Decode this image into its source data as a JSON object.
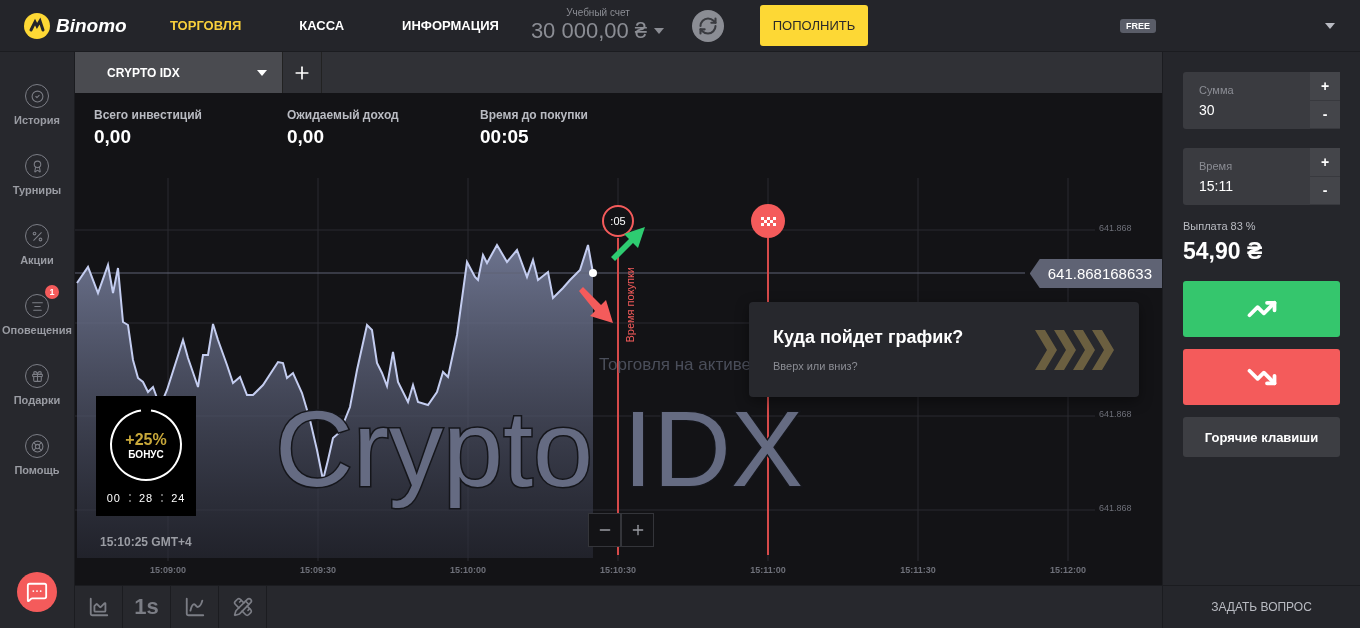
{
  "header": {
    "logo": "Binomo",
    "nav": [
      {
        "label": "ТОРГОВЛЯ",
        "selected": true
      },
      {
        "label": "КАССА",
        "selected": false
      },
      {
        "label": "ИНФОРМАЦИЯ",
        "selected": false
      }
    ],
    "account": {
      "label": "Учебный счет",
      "balance": "30 000,00 ₴"
    },
    "deposit_button": "ПОПОЛНИТЬ",
    "badge": "FREE"
  },
  "sidebar": {
    "items": [
      {
        "label": "История"
      },
      {
        "label": "Турниры"
      },
      {
        "label": "Акции"
      },
      {
        "label": "Оповещения",
        "badge": "1"
      },
      {
        "label": "Подарки"
      },
      {
        "label": "Помощь"
      }
    ]
  },
  "asset_tabs": [
    {
      "label": "CRYPTO IDX",
      "selected": true
    }
  ],
  "stats": [
    {
      "label": "Всего инвестиций",
      "value": "0,00"
    },
    {
      "label": "Ожидаемый доход",
      "value": "0,00"
    },
    {
      "label": "Время до покупки",
      "value": "00:05"
    }
  ],
  "chart": {
    "watermark": "Crypto IDX",
    "subtitle": "Торговля на активе",
    "countdown": ":05",
    "purchase_label": "Время покупки",
    "current_price": "641.868168633",
    "y_ticks": [
      "641.868",
      "641.868",
      "641.868"
    ],
    "x_ticks": [
      "15:09:00",
      "15:09:30",
      "15:10:00",
      "15:10:30",
      "15:11:00",
      "15:11:30",
      "15:12:00"
    ],
    "clock": "15:10:25 GMT+4"
  },
  "prompt": {
    "title": "Куда пойдет график?",
    "subtitle": "Вверх или вниз?"
  },
  "bonus": {
    "percent": "+25%",
    "label": "БОНУС",
    "timer": [
      "00",
      "28",
      "24"
    ]
  },
  "toolbar": {
    "interval": "1s"
  },
  "trade": {
    "fields": [
      {
        "label": "Сумма",
        "value": "30",
        "increment": "+",
        "decrement": "-"
      },
      {
        "label": "Время",
        "value": "15:11",
        "increment": "+",
        "decrement": "-"
      }
    ],
    "payout_label": "Выплата 83 %",
    "payout": "54,90 ₴",
    "hotkeys": "Горячие клавиши"
  },
  "footer": {
    "ask": "ЗАДАТЬ ВОПРОС"
  }
}
